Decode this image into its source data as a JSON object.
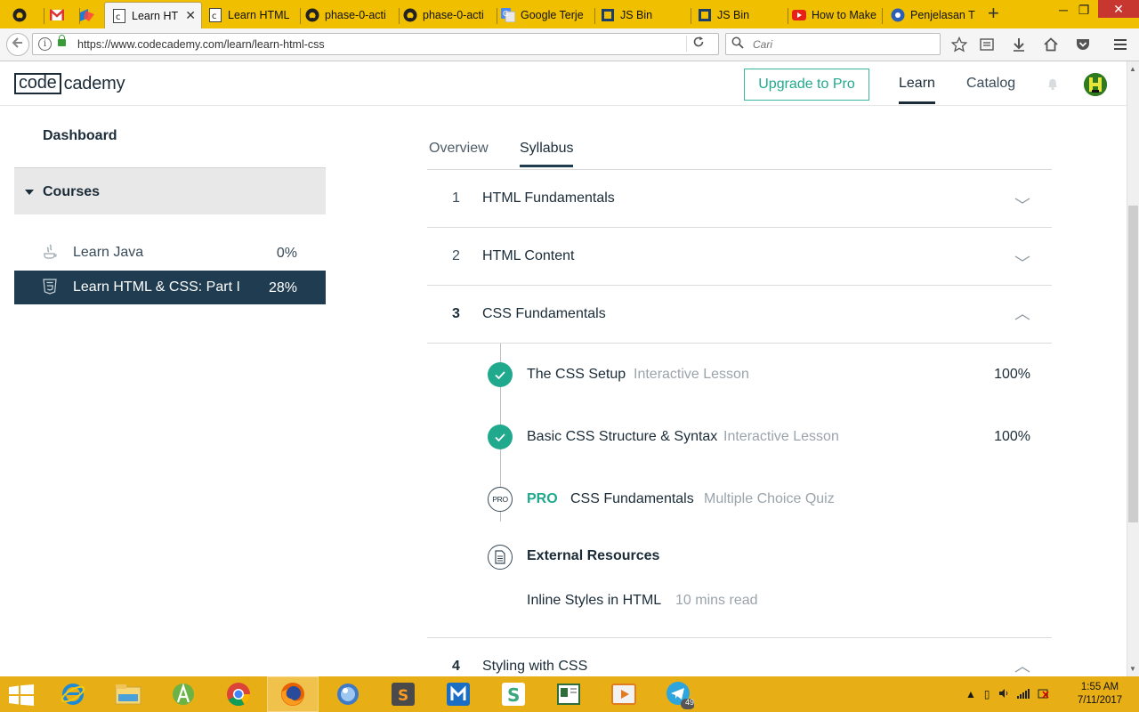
{
  "browser": {
    "tabs": [
      {
        "label": "",
        "icon": "github-icon"
      },
      {
        "label": "",
        "icon": "gmail-icon"
      },
      {
        "label": "",
        "icon": "app-icon"
      },
      {
        "label": "Learn HT",
        "icon": "codecademy-icon",
        "active": true
      },
      {
        "label": "Learn HTML",
        "icon": "codecademy-icon"
      },
      {
        "label": "phase-0-acti",
        "icon": "github-icon"
      },
      {
        "label": "phase-0-acti",
        "icon": "github-icon"
      },
      {
        "label": "Google Terje",
        "icon": "google-translate-icon"
      },
      {
        "label": "JS Bin",
        "icon": "jsbin-icon"
      },
      {
        "label": "JS Bin",
        "icon": "jsbin-icon"
      },
      {
        "label": "How to Make",
        "icon": "youtube-icon"
      },
      {
        "label": "Penjelasan T",
        "icon": "site-icon"
      }
    ],
    "url": "https://www.codecademy.com/learn/learn-html-css",
    "search_placeholder": "Cari"
  },
  "header": {
    "logo_box": "code",
    "logo_rest": "cademy",
    "upgrade": "Upgrade to Pro",
    "nav_learn": "Learn",
    "nav_catalog": "Catalog"
  },
  "sidebar": {
    "dashboard": "Dashboard",
    "courses_label": "Courses",
    "courses": [
      {
        "name": "Learn Java",
        "progress": "0%",
        "icon": "java-icon"
      },
      {
        "name": "Learn HTML & CSS: Part I",
        "progress": "28%",
        "icon": "html5-icon"
      }
    ]
  },
  "main": {
    "tabs": [
      {
        "label": "Overview"
      },
      {
        "label": "Syllabus"
      }
    ],
    "units": [
      {
        "num": "1",
        "title": "HTML Fundamentals"
      },
      {
        "num": "2",
        "title": "HTML Content"
      },
      {
        "num": "3",
        "title": "CSS Fundamentals"
      },
      {
        "num": "4",
        "title": "Styling with CSS"
      }
    ],
    "lessons": [
      {
        "title": "The CSS Setup",
        "kind": "Interactive Lesson",
        "progress": "100%"
      },
      {
        "title": "Basic CSS Structure & Syntax",
        "kind": "Interactive Lesson",
        "progress": "100%"
      },
      {
        "pro_badge": "PRO",
        "pro_tag": "PRO",
        "title": "CSS Fundamentals",
        "kind": "Multiple Choice Quiz"
      }
    ],
    "external": {
      "title": "External Resources",
      "item_title": "Inline Styles in HTML",
      "item_meta": "10 mins read"
    }
  },
  "taskbar": {
    "telegram_badge": "49",
    "time": "1:55 AM",
    "date": "7/11/2017"
  },
  "colors": {
    "accent": "#21a98e",
    "navy": "#1f3c51",
    "taskbar": "#e7ae16"
  }
}
